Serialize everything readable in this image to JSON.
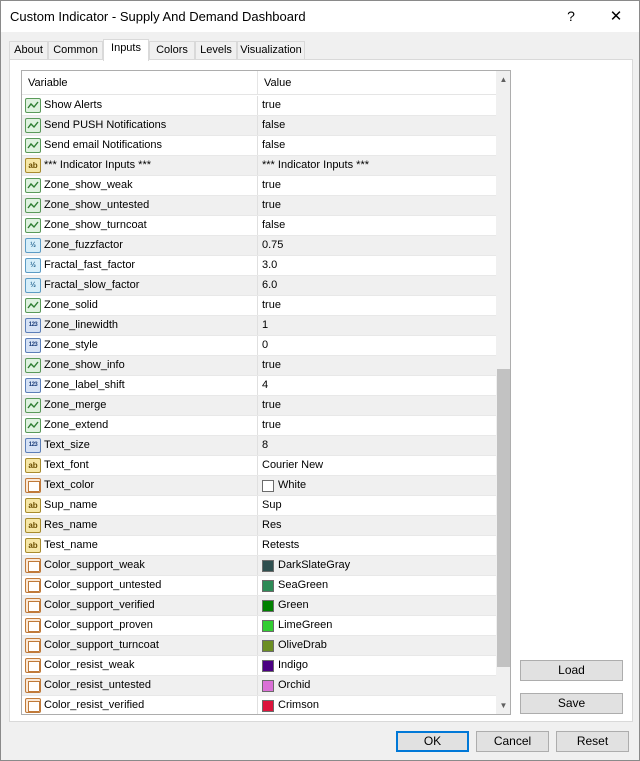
{
  "window": {
    "title": "Custom Indicator - Supply And Demand Dashboard",
    "help_label": "?",
    "close_label": "✕"
  },
  "tabs": [
    {
      "label": "About"
    },
    {
      "label": "Common"
    },
    {
      "label": "Inputs",
      "active": true
    },
    {
      "label": "Colors"
    },
    {
      "label": "Levels"
    },
    {
      "label": "Visualization"
    }
  ],
  "grid": {
    "header": {
      "variable": "Variable",
      "value": "Value"
    },
    "rows": [
      {
        "type": "bool",
        "name": "Show Alerts",
        "value": "true"
      },
      {
        "type": "bool",
        "name": "Send PUSH Notifications",
        "value": "false"
      },
      {
        "type": "bool",
        "name": "Send email Notifications",
        "value": "false"
      },
      {
        "type": "string",
        "name": "*** Indicator Inputs ***",
        "value": "*** Indicator Inputs ***"
      },
      {
        "type": "bool",
        "name": "Zone_show_weak",
        "value": "true"
      },
      {
        "type": "bool",
        "name": "Zone_show_untested",
        "value": "true"
      },
      {
        "type": "bool",
        "name": "Zone_show_turncoat",
        "value": "false"
      },
      {
        "type": "double",
        "name": "Zone_fuzzfactor",
        "value": "0.75"
      },
      {
        "type": "double",
        "name": "Fractal_fast_factor",
        "value": "3.0"
      },
      {
        "type": "double",
        "name": "Fractal_slow_factor",
        "value": "6.0"
      },
      {
        "type": "bool",
        "name": "Zone_solid",
        "value": "true"
      },
      {
        "type": "int",
        "name": "Zone_linewidth",
        "value": "1"
      },
      {
        "type": "int",
        "name": "Zone_style",
        "value": "0"
      },
      {
        "type": "bool",
        "name": "Zone_show_info",
        "value": "true"
      },
      {
        "type": "int",
        "name": "Zone_label_shift",
        "value": "4"
      },
      {
        "type": "bool",
        "name": "Zone_merge",
        "value": "true"
      },
      {
        "type": "bool",
        "name": "Zone_extend",
        "value": "true"
      },
      {
        "type": "int",
        "name": "Text_size",
        "value": "8"
      },
      {
        "type": "string",
        "name": "Text_font",
        "value": "Courier New"
      },
      {
        "type": "color",
        "name": "Text_color",
        "value": "White",
        "color": "#ffffff"
      },
      {
        "type": "string",
        "name": "Sup_name",
        "value": "Sup"
      },
      {
        "type": "string",
        "name": "Res_name",
        "value": "Res"
      },
      {
        "type": "string",
        "name": "Test_name",
        "value": "Retests"
      },
      {
        "type": "color",
        "name": "Color_support_weak",
        "value": "DarkSlateGray",
        "color": "#2f4f4f"
      },
      {
        "type": "color",
        "name": "Color_support_untested",
        "value": "SeaGreen",
        "color": "#2e8b57"
      },
      {
        "type": "color",
        "name": "Color_support_verified",
        "value": "Green",
        "color": "#008000"
      },
      {
        "type": "color",
        "name": "Color_support_proven",
        "value": "LimeGreen",
        "color": "#32cd32"
      },
      {
        "type": "color",
        "name": "Color_support_turncoat",
        "value": "OliveDrab",
        "color": "#6b8e23"
      },
      {
        "type": "color",
        "name": "Color_resist_weak",
        "value": "Indigo",
        "color": "#4b0082"
      },
      {
        "type": "color",
        "name": "Color_resist_untested",
        "value": "Orchid",
        "color": "#da70d6"
      },
      {
        "type": "color",
        "name": "Color_resist_verified",
        "value": "Crimson",
        "color": "#dc143c"
      }
    ]
  },
  "icon_labels": {
    "bool": "",
    "string": "ab",
    "double": "½",
    "int": "123",
    "color": ""
  },
  "side_buttons": {
    "load": "Load",
    "save": "Save"
  },
  "footer_buttons": {
    "ok": "OK",
    "cancel": "Cancel",
    "reset": "Reset"
  },
  "scrollbar": {
    "up_icon": "▲",
    "down_icon": "▼"
  }
}
